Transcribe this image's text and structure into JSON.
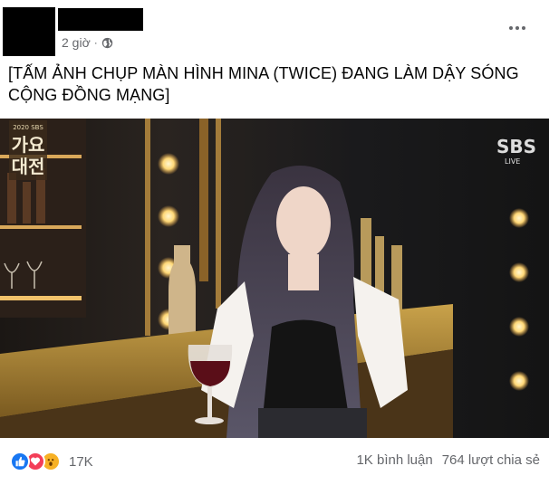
{
  "post": {
    "timestamp": "2 giờ",
    "separator": "·",
    "caption": "[TẤM ẢNH CHỤP MÀN HÌNH MINA (TWICE) ĐANG LÀM DẬY SÓNG CỘNG ĐỒNG MẠNG]",
    "privacy_icon": "globe-icon",
    "more_icon": "ellipsis-icon"
  },
  "photo": {
    "broadcaster_logo": "SBS",
    "live_label": "LIVE",
    "show_logo_line1": "가요",
    "show_logo_line2": "대전",
    "show_logo_year": "2020 SBS"
  },
  "footer": {
    "reaction_icons": [
      "like-icon",
      "love-icon",
      "wow-icon"
    ],
    "reaction_count": "17K",
    "comments": "1K bình luận",
    "shares": "764 lượt chia sẻ"
  },
  "colors": {
    "like": "#1877f2",
    "love": "#f33e58",
    "wow": "#f7b125",
    "secondary_text": "#65676b"
  }
}
